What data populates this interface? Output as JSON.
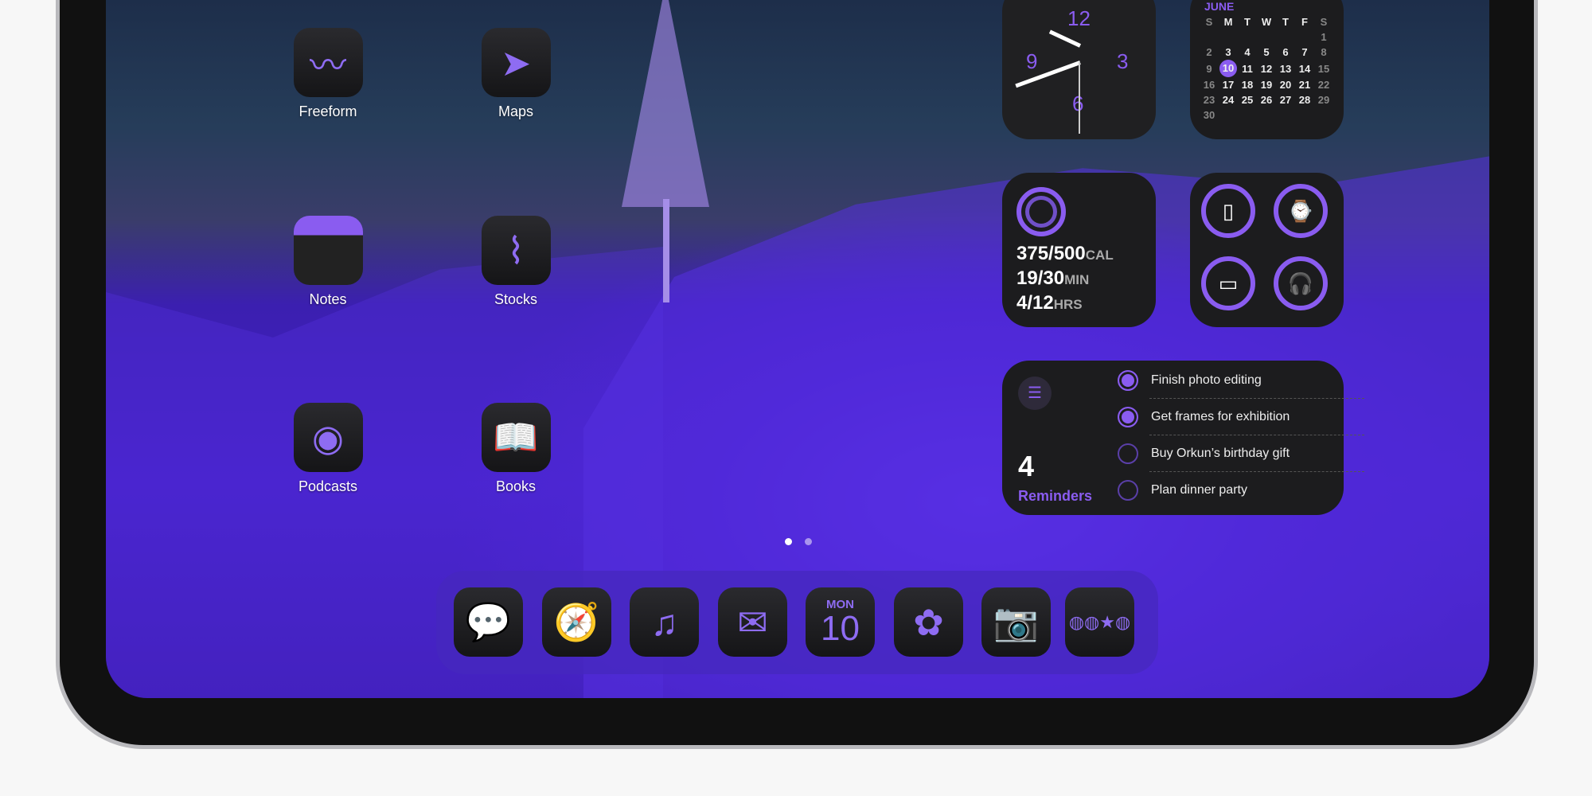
{
  "apps": [
    {
      "label": "Freeform",
      "icon": "freeform-icon"
    },
    {
      "label": "Maps",
      "icon": "maps-icon"
    },
    {
      "label": "Notes",
      "icon": "notes-icon"
    },
    {
      "label": "Stocks",
      "icon": "stocks-icon"
    },
    {
      "label": "Podcasts",
      "icon": "podcasts-icon"
    },
    {
      "label": "Books",
      "icon": "books-icon"
    }
  ],
  "clock": {
    "n12": "12",
    "n3": "3",
    "n6": "6",
    "n9": "9"
  },
  "calendar": {
    "month": "JUNE",
    "days": [
      "S",
      "M",
      "T",
      "W",
      "T",
      "F",
      "S"
    ],
    "today": "10",
    "weeks": [
      [
        "",
        "",
        "",
        "",
        "",
        "",
        "1"
      ],
      [
        "2",
        "3",
        "4",
        "5",
        "6",
        "7",
        "8"
      ],
      [
        "9",
        "10",
        "11",
        "12",
        "13",
        "14",
        "15"
      ],
      [
        "16",
        "17",
        "18",
        "19",
        "20",
        "21",
        "22"
      ],
      [
        "23",
        "24",
        "25",
        "26",
        "27",
        "28",
        "29"
      ],
      [
        "30",
        "",
        "",
        "",
        "",
        "",
        ""
      ]
    ]
  },
  "activity": {
    "move": "375/500",
    "move_unit": "CAL",
    "exercise": "19/30",
    "exercise_unit": "MIN",
    "stand": "4/12",
    "stand_unit": "HRS"
  },
  "reminders": {
    "count": "4",
    "title": "Reminders",
    "items": [
      {
        "text": "Finish photo editing",
        "done": true
      },
      {
        "text": "Get frames for exhibition",
        "done": true
      },
      {
        "text": "Buy Orkun’s birthday gift",
        "done": false
      },
      {
        "text": "Plan dinner party",
        "done": false
      }
    ]
  },
  "dock": {
    "calendar_day": "MON",
    "calendar_date": "10",
    "apps": [
      "messages-icon",
      "safari-icon",
      "music-icon",
      "mail-icon",
      "calendar-icon",
      "photos-icon",
      "camera-icon",
      "app-library-icon"
    ]
  },
  "page_indicator": {
    "pages": 2,
    "current": 1
  },
  "colors": {
    "accent": "#8a5cf0",
    "widget_bg": "#1c1c1e"
  }
}
